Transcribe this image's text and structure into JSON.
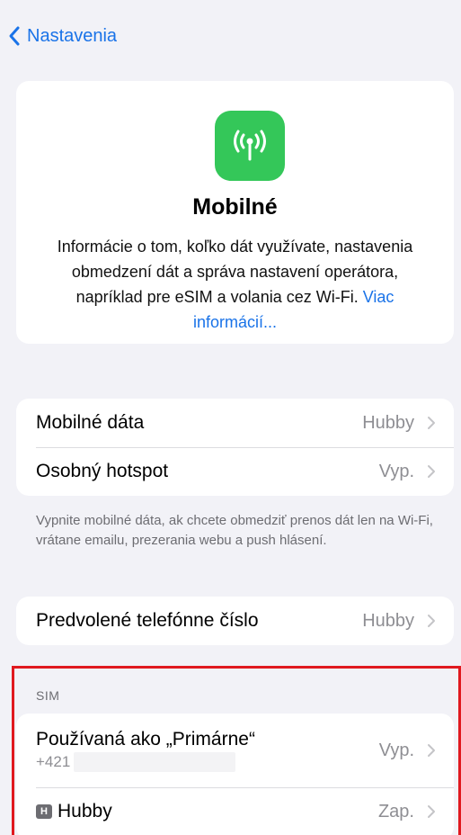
{
  "nav": {
    "back_label": "Nastavenia"
  },
  "hero": {
    "title": "Mobilné",
    "description": "Informácie o tom, koľko dát využívate, nastavenia obmedzení dát a správa nastavení operátora, napríklad pre eSIM a volania cez Wi-Fi.",
    "link": "Viac informácií..."
  },
  "group1": {
    "rows": [
      {
        "label": "Mobilné dáta",
        "value": "Hubby"
      },
      {
        "label": "Osobný hotspot",
        "value": "Vyp."
      }
    ],
    "footnote": "Vypnite mobilné dáta, ak chcete obmedziť prenos dát len na Wi-Fi, vrátane emailu, prezerania webu a push hlásení."
  },
  "group2": {
    "row": {
      "label": "Predvolené telefónne číslo",
      "value": "Hubby"
    }
  },
  "sim": {
    "header": "SIM",
    "primary": {
      "label": "Používaná ako „Primárne“",
      "number": "+421",
      "value": "Vyp."
    },
    "hubby": {
      "badge": "H",
      "label": "Hubby",
      "value": "Zap."
    }
  },
  "colors": {
    "accent": "#1a73e8",
    "icon_bg": "#34c759",
    "highlight": "#e0191f"
  },
  "icons": {
    "back": "chevron-left-icon",
    "app": "antenna-icon",
    "row": "chevron-right-icon"
  }
}
